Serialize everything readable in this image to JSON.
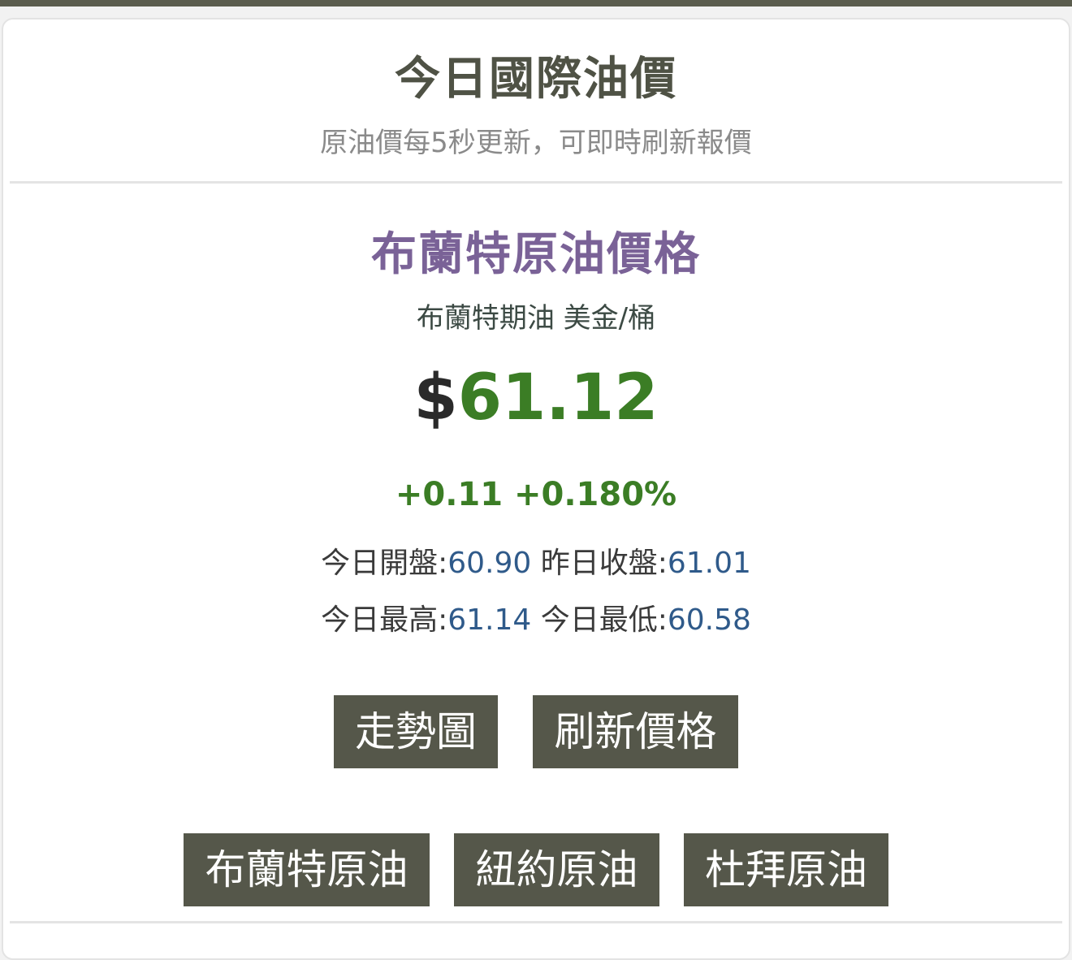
{
  "header": {
    "title": "今日國際油價",
    "subtitle": "原油價每5秒更新，可即時刷新報價"
  },
  "quote": {
    "name": "布蘭特原油價格",
    "unit": "布蘭特期油 美金/桶",
    "currency_symbol": "$",
    "price": "61.12",
    "change": "+0.11 +0.180%",
    "open_label": "今日開盤:",
    "open_value": "60.90",
    "prev_close_label": "昨日收盤:",
    "prev_close_value": "61.01",
    "high_label": "今日最高:",
    "high_value": "61.14",
    "low_label": "今日最低:",
    "low_value": "60.58"
  },
  "actions": {
    "trend_label": "走勢圖",
    "refresh_label": "刷新價格"
  },
  "oil_types": [
    {
      "label": "布蘭特原油"
    },
    {
      "label": "紐約原油"
    },
    {
      "label": "杜拜原油"
    }
  ],
  "colors": {
    "button_bg": "#55574a",
    "title_color": "#4f5245",
    "oil_title_color": "#7a6297",
    "price_up_color": "#3b7d25",
    "stat_value_color": "#2f5a8a"
  }
}
